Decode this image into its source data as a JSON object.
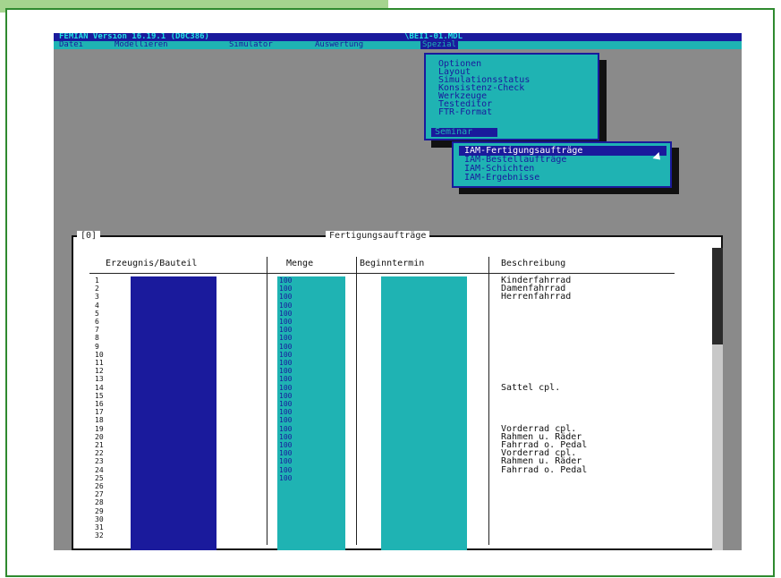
{
  "app": {
    "title": "FEMIAN Version 16.19.1 (D0C386)",
    "file": "\\BEI1-01.MDL"
  },
  "menubar": {
    "items": [
      "Datei",
      "Modellieren",
      "Simulator",
      "Auswertung",
      "Spezial"
    ],
    "active": "Spezial"
  },
  "dropdown": {
    "items": [
      "Optionen",
      "Layout",
      "Simulationsstatus",
      "Konsistenz-Check",
      "Werkzeuge",
      "Testeditor",
      "FTR-Format"
    ],
    "selected": "Seminar"
  },
  "submenu": {
    "items": [
      "IAM-Fertigungsaufträge",
      "IAM-Bestellaufträge",
      "IAM-Schichten",
      "IAM-Ergebnisse"
    ],
    "selected": "IAM-Fertigungsaufträge"
  },
  "window": {
    "number": "[0]",
    "title": "Fertigungsaufträge",
    "columns": [
      "Erzeugnis/Bauteil",
      "Menge",
      "Beginntermin",
      "Beschreibung"
    ],
    "rows": [
      "1",
      "2",
      "3",
      "4",
      "5",
      "6",
      "7",
      "8",
      "9",
      "10",
      "11",
      "12",
      "13",
      "14",
      "15",
      "16",
      "17",
      "18",
      "19",
      "20",
      "21",
      "22",
      "23",
      "24",
      "25",
      "26",
      "27",
      "28",
      "29",
      "30",
      "31",
      "32"
    ],
    "mengen": [
      "100",
      "100",
      "100",
      "100",
      "100",
      "100",
      "100",
      "100",
      "100",
      "100",
      "100",
      "100",
      "100",
      "100",
      "100",
      "100",
      "100",
      "100",
      "100",
      "100",
      "100",
      "100",
      "100",
      "100",
      "100"
    ],
    "descriptions": [
      {
        "row": 1,
        "text": "Kinderfahrrad"
      },
      {
        "row": 2,
        "text": "Damenfahrrad"
      },
      {
        "row": 3,
        "text": "Herrenfahrrad"
      },
      {
        "row": 14,
        "text": "Sattel cpl."
      },
      {
        "row": 19,
        "text": "Vorderrad cpl."
      },
      {
        "row": 20,
        "text": "Rahmen u. Räder"
      },
      {
        "row": 21,
        "text": "Fahrrad o. Pedal"
      },
      {
        "row": 22,
        "text": "Vorderrad cpl."
      },
      {
        "row": 23,
        "text": "Rahmen u. Räder"
      },
      {
        "row": 24,
        "text": "Fahrrad o. Pedal"
      }
    ]
  },
  "colors": {
    "navy": "#1a1a9c",
    "cyan": "#1fb3b3",
    "frame_green": "#2f8a2f",
    "tab_green": "#a5d48f"
  }
}
